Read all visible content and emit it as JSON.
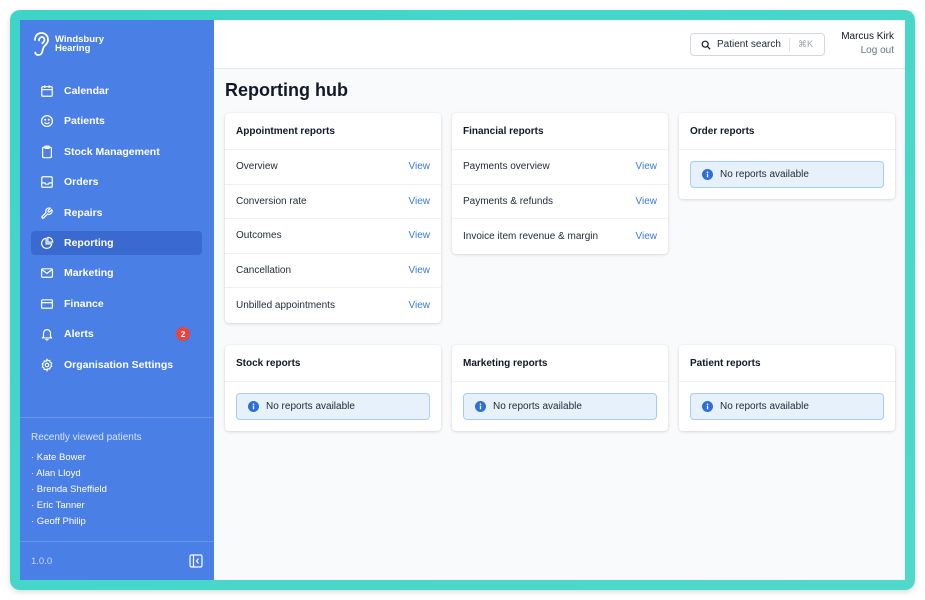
{
  "brand": {
    "name": "Windsbury Hearing"
  },
  "sidebar": {
    "items": [
      {
        "label": "Calendar",
        "icon": "calendar-icon"
      },
      {
        "label": "Patients",
        "icon": "smiley-icon"
      },
      {
        "label": "Stock Management",
        "icon": "clipboard-icon"
      },
      {
        "label": "Orders",
        "icon": "inbox-icon"
      },
      {
        "label": "Repairs",
        "icon": "wrench-icon"
      },
      {
        "label": "Reporting",
        "icon": "pie-chart-icon",
        "active": true
      },
      {
        "label": "Marketing",
        "icon": "mail-icon"
      },
      {
        "label": "Finance",
        "icon": "credit-card-icon"
      },
      {
        "label": "Alerts",
        "icon": "bell-icon",
        "badge": "2"
      },
      {
        "label": "Organisation Settings",
        "icon": "gear-icon"
      }
    ],
    "recent_title": "Recently viewed patients",
    "recent": [
      "· Kate Bower",
      "· Alan Lloyd",
      "· Brenda Sheffield",
      "· Eric Tanner",
      "· Geoff Philip"
    ],
    "version": "1.0.0"
  },
  "header": {
    "search_label": "Patient search",
    "search_shortcut": "⌘K",
    "user_name": "Marcus Kirk",
    "logout_label": "Log out"
  },
  "main": {
    "title": "Reporting hub",
    "cards": [
      {
        "title": "Appointment reports",
        "rows": [
          {
            "label": "Overview",
            "action": "View"
          },
          {
            "label": "Conversion rate",
            "action": "View"
          },
          {
            "label": "Outcomes",
            "action": "View"
          },
          {
            "label": "Cancellation",
            "action": "View"
          },
          {
            "label": "Unbilled appointments",
            "action": "View"
          }
        ]
      },
      {
        "title": "Financial reports",
        "rows": [
          {
            "label": "Payments overview",
            "action": "View"
          },
          {
            "label": "Payments & refunds",
            "action": "View"
          },
          {
            "label": "Invoice item revenue & margin",
            "action": "View"
          }
        ]
      },
      {
        "title": "Order reports",
        "empty": "No reports available"
      },
      {
        "title": "Stock reports",
        "empty": "No reports available"
      },
      {
        "title": "Marketing reports",
        "empty": "No reports available"
      },
      {
        "title": "Patient reports",
        "empty": "No reports available"
      }
    ]
  },
  "colors": {
    "sidebar": "#4a7fe6",
    "sidebar_active": "#3a69cf",
    "link": "#3b7be0",
    "badge": "#e8453c",
    "info_bg": "#e6f1fc",
    "frame": "#3fd4c8"
  }
}
